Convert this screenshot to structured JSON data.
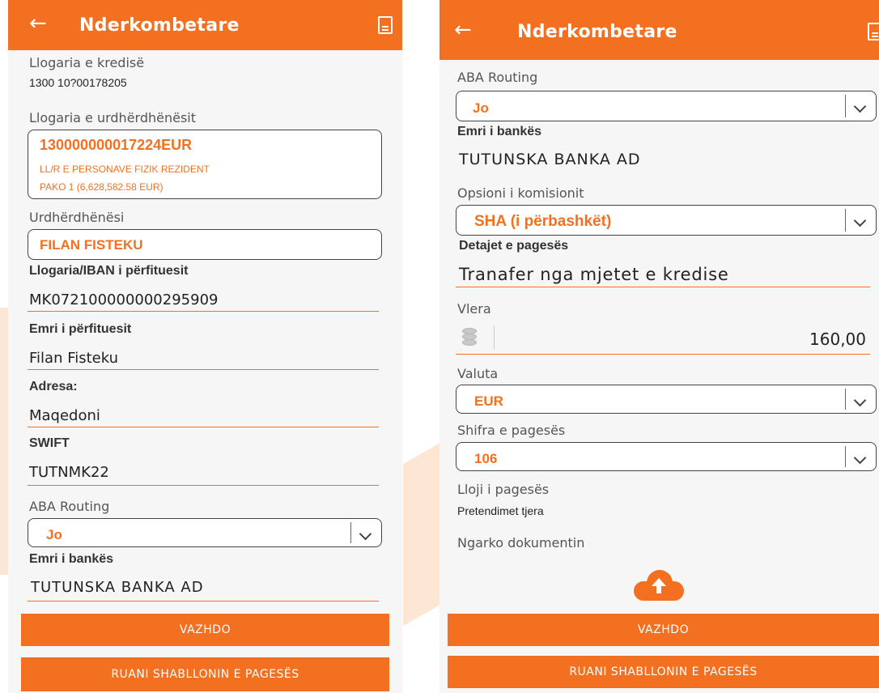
{
  "colors": {
    "accent": "#f37021"
  },
  "left": {
    "title": "Nderkombetare",
    "credit_account": {
      "label": "Llogaria e kredisë",
      "value": "1300 10?00178205"
    },
    "orderer_account": {
      "label": "Llogaria e urdhërdhënësit",
      "line1": "130000000017224EUR",
      "line2": "LL/R E PERSONAVE FIZIK REZIDENT",
      "line3": "PAKO 1 (6,628,582.58 EUR)"
    },
    "orderer": {
      "label": "Urdhërdhënësi",
      "value": "FILAN FISTEKU"
    },
    "iban": {
      "label": "Llogaria/IBAN i përfituesit",
      "value": "MK072100000000295909"
    },
    "beneficiary": {
      "label": "Emri i përfituesit",
      "value": "Filan Fisteku"
    },
    "address": {
      "label": "Adresa:",
      "value": "Maqedoni"
    },
    "swift": {
      "label": "SWIFT",
      "value": "TUTNMK22"
    },
    "aba": {
      "label": "ABA Routing",
      "value": "Jo"
    },
    "bank": {
      "label": "Emri i bankës",
      "value": "TUTUNSKA BANKA AD"
    },
    "continue_btn": "VAZHDO",
    "save_btn": "RUANI SHABLLONIN E PAGESËS"
  },
  "right": {
    "title": "Nderkombetare",
    "aba": {
      "label": "ABA Routing",
      "value": "Jo"
    },
    "bank": {
      "label": "Emri i bankës",
      "value": "TUTUNSKA BANKA AD"
    },
    "commission": {
      "label": "Opsioni i komisionit",
      "value": "SHA (i përbashkët)"
    },
    "details": {
      "label": "Detajet e pagesës",
      "value": "Tranafer nga mjetet e kredise"
    },
    "amount": {
      "label": "Vlera",
      "value": "160,00"
    },
    "currency": {
      "label": "Valuta",
      "value": "EUR"
    },
    "code": {
      "label": "Shifra e pagesës",
      "value": "106"
    },
    "type": {
      "label": "Lloji i pagesës",
      "value": "Pretendimet tjera"
    },
    "upload": {
      "label": "Ngarko dokumentin"
    },
    "continue_btn": "VAZHDO",
    "save_btn": "RUANI SHABLLONIN E PAGESËS"
  }
}
